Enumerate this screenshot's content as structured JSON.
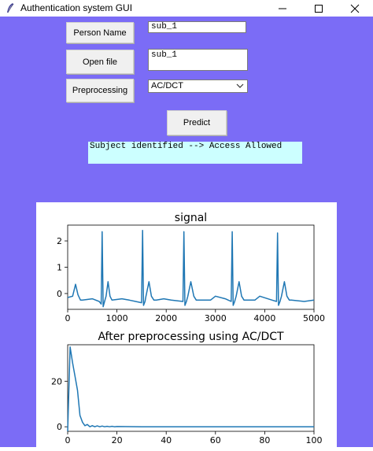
{
  "window": {
    "title": "Authentication system GUI"
  },
  "form": {
    "person_name_label": "Person Name",
    "person_name_value": "sub_1",
    "open_file_label": "Open file",
    "open_file_value": "sub_1",
    "preprocessing_label": "Preprocessing",
    "preprocessing_value": "AC/DCT",
    "predict_label": "Predict",
    "result_text": "Subject identified --> Access Allowed"
  },
  "colors": {
    "background": "#7b6cf6",
    "result_bg": "#ccffff",
    "plot_line": "#1f77b4"
  },
  "chart_data": [
    {
      "type": "line",
      "title": "signal",
      "xlim": [
        0,
        5000
      ],
      "ylim": [
        -0.6,
        2.6
      ],
      "xticks": [
        0,
        1000,
        2000,
        3000,
        4000,
        5000
      ],
      "yticks": [
        0,
        1,
        2
      ],
      "series": [
        {
          "x": [
            0,
            100,
            160,
            210,
            260,
            300,
            500,
            640,
            680,
            700,
            720,
            750,
            780,
            820,
            860,
            900,
            1100,
            1250,
            1500,
            1520,
            1540,
            1570,
            1590,
            1650,
            1700,
            1750,
            1800,
            1950,
            2100,
            2340,
            2360,
            2380,
            2410,
            2440,
            2500,
            2560,
            2610,
            2650,
            2900,
            3000,
            3200,
            3320,
            3340,
            3360,
            3390,
            3420,
            3480,
            3530,
            3580,
            3620,
            3800,
            3900,
            4150,
            4240,
            4260,
            4280,
            4310,
            4340,
            4400,
            4450,
            4500,
            4540,
            4800,
            5000
          ],
          "y": [
            -0.15,
            -0.1,
            0.35,
            -0.05,
            -0.25,
            -0.25,
            -0.2,
            -0.3,
            -0.4,
            2.35,
            -0.5,
            -0.3,
            -0.1,
            0.45,
            -0.1,
            -0.25,
            -0.2,
            -0.25,
            -0.35,
            2.4,
            -0.45,
            -0.3,
            -0.1,
            0.45,
            -0.1,
            -0.25,
            -0.25,
            -0.2,
            -0.25,
            -0.3,
            2.35,
            -0.45,
            -0.3,
            -0.1,
            0.45,
            -0.1,
            -0.25,
            -0.25,
            -0.25,
            -0.1,
            -0.2,
            -0.3,
            2.35,
            -0.45,
            -0.3,
            -0.1,
            0.45,
            -0.1,
            -0.25,
            -0.25,
            -0.25,
            -0.1,
            -0.25,
            -0.3,
            2.3,
            -0.45,
            -0.3,
            -0.1,
            0.45,
            -0.1,
            -0.25,
            -0.25,
            -0.3,
            -0.25
          ]
        }
      ]
    },
    {
      "type": "line",
      "title": "After preprocessing using AC/DCT",
      "xlim": [
        0,
        100
      ],
      "ylim": [
        -2,
        36
      ],
      "xticks": [
        0,
        20,
        40,
        60,
        80,
        100
      ],
      "yticks": [
        0,
        20
      ],
      "series": [
        {
          "x": [
            0,
            1,
            2,
            3,
            4,
            5,
            6,
            7,
            8,
            9,
            10,
            11,
            12,
            13,
            14,
            15,
            16,
            17,
            18,
            19,
            20,
            30,
            40,
            50,
            60,
            70,
            80,
            90,
            100
          ],
          "y": [
            -2,
            35,
            28,
            22,
            16,
            5,
            2,
            0.5,
            1,
            0,
            0.5,
            0,
            0.4,
            0,
            0.3,
            0,
            0.2,
            0,
            0.2,
            0,
            0.1,
            0,
            0,
            0,
            0,
            0,
            0,
            0,
            0
          ]
        }
      ]
    }
  ]
}
